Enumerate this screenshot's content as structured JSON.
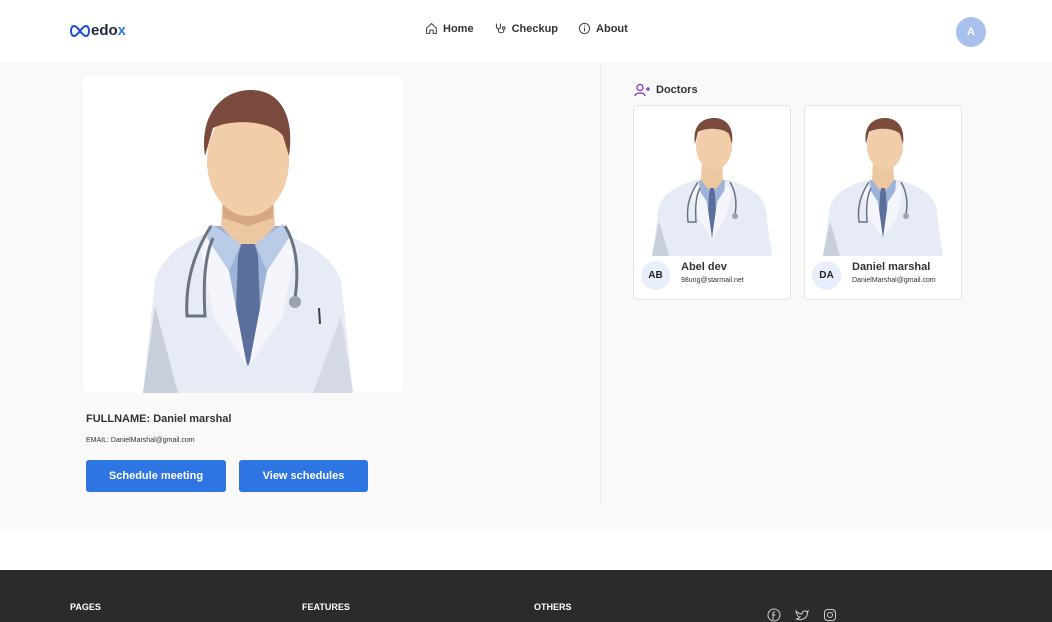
{
  "brand": {
    "logo_text": "edo",
    "logo_suffix": "x"
  },
  "nav": {
    "items": [
      {
        "label": "Home",
        "icon": "home-icon"
      },
      {
        "label": "Checkup",
        "icon": "stethoscope-icon"
      },
      {
        "label": "About",
        "icon": "info-icon"
      }
    ]
  },
  "user": {
    "initial": "A"
  },
  "profile": {
    "fullname": "FULLNAME: Daniel marshal",
    "email": "EMAIL: DanielMarshal@gmail.com",
    "schedule_button": "Schedule meeting",
    "view_button": "View schedules"
  },
  "doctors": {
    "title": "Doctors",
    "list": [
      {
        "initials": "AB",
        "name": "Abel dev",
        "email": "98ung@starmail.net"
      },
      {
        "initials": "DA",
        "name": "Daniel marshal",
        "email": "DanielMarshal@gmail.com"
      }
    ]
  },
  "footer": {
    "columns": [
      "PAGES",
      "FEATURES",
      "OTHERS"
    ],
    "social": [
      "facebook-icon",
      "twitter-icon",
      "instagram-icon"
    ]
  },
  "colors": {
    "accent": "#2f74e3",
    "avatar": "#a8c1ec",
    "footer": "#2b2b2b"
  }
}
